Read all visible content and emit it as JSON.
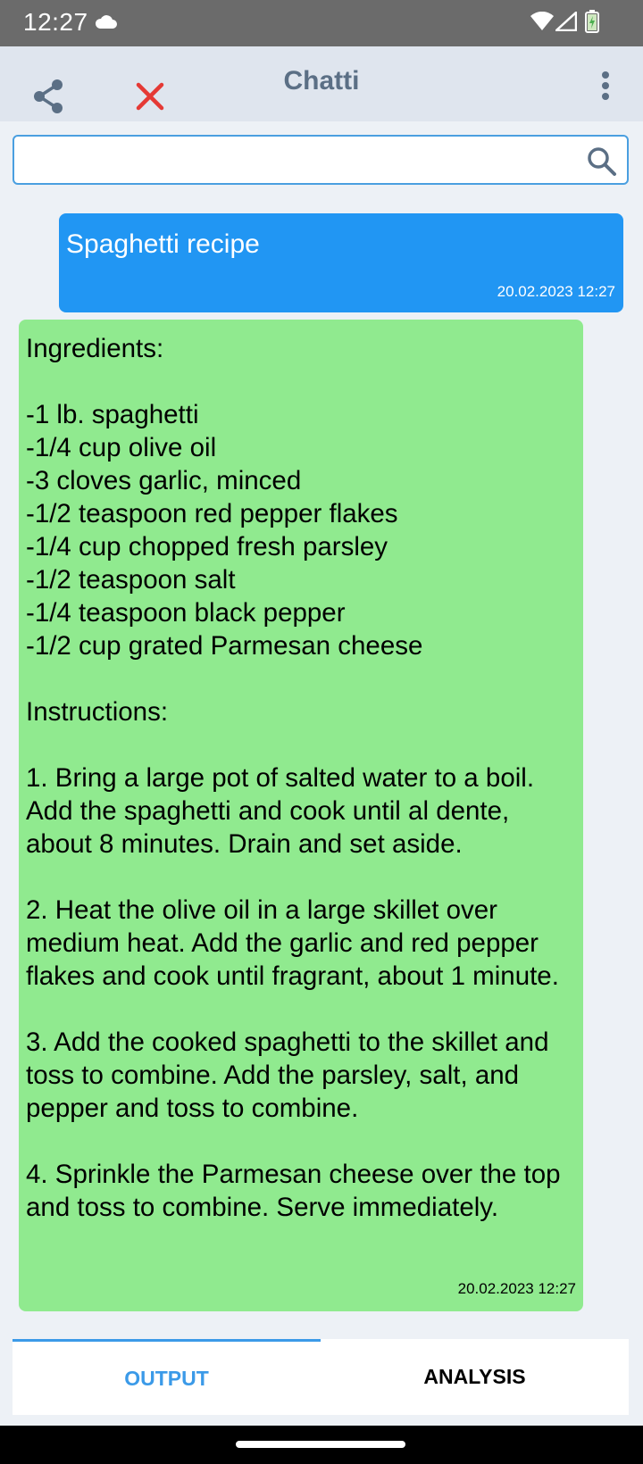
{
  "status_bar": {
    "time": "12:27",
    "icons": [
      "cloud-icon",
      "wifi-icon",
      "signal-icon",
      "battery-charging-icon"
    ]
  },
  "app_bar": {
    "title": "Chatti",
    "share_icon": "share-icon",
    "close_icon": "close-icon",
    "more_icon": "more-vertical-icon",
    "close_color": "#e53935",
    "title_color": "#5b6f85"
  },
  "search": {
    "value": "",
    "placeholder": "",
    "icon": "search-icon",
    "border_color": "#4a9fe0"
  },
  "messages": [
    {
      "role": "user",
      "text": "Spaghetti recipe",
      "timestamp": "20.02.2023 12:27",
      "color": "#2196f3"
    },
    {
      "role": "assistant",
      "text": "Ingredients:\n\n-1 lb. spaghetti\n-1/4 cup olive oil\n-3 cloves garlic, minced\n-1/2 teaspoon red pepper flakes\n-1/4 cup chopped fresh parsley\n-1/2 teaspoon salt\n-1/4 teaspoon black pepper\n-1/2 cup grated Parmesan cheese\n\nInstructions:\n\n1. Bring a large pot of salted water to a boil. Add the spaghetti and cook until al dente, about 8 minutes. Drain and set aside.\n\n2. Heat the olive oil in a large skillet over medium heat. Add the garlic and red pepper flakes and cook until fragrant, about 1 minute.\n\n3. Add the cooked spaghetti to the skillet and toss to combine. Add the parsley, salt, and pepper and toss to combine.\n\n4. Sprinkle the Parmesan cheese over the top and toss to combine. Serve immediately.",
      "timestamp": "20.02.2023 12:27",
      "color": "#90ea8f"
    }
  ],
  "tabs": [
    {
      "label": "OUTPUT",
      "active": true
    },
    {
      "label": "ANALYSIS",
      "active": false
    }
  ],
  "colors": {
    "accent": "#3b9ae8",
    "background": "#edf1f6",
    "app_bar": "#dfe5ee"
  }
}
